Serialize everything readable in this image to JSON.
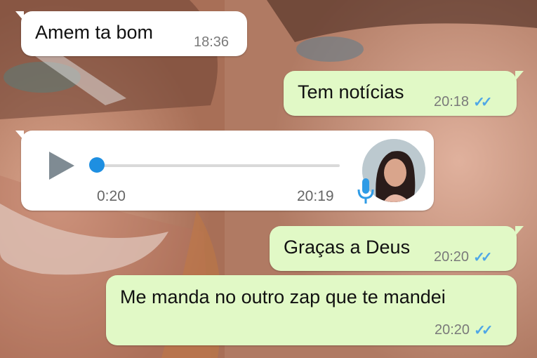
{
  "messages": [
    {
      "text": "Amem ta bom",
      "time": "18:36"
    },
    {
      "text": "Tem notícias",
      "time": "20:18"
    },
    {
      "voice_duration": "0:20",
      "time": "20:19"
    },
    {
      "text": "Graças a Deus",
      "time": "20:20"
    },
    {
      "text": "Me manda no outro zap que te mandei",
      "time": "20:20"
    }
  ],
  "colors": {
    "incoming_bubble": "#ffffff",
    "outgoing_bubble": "#e1f9c6",
    "read_ticks": "#4fa7e6",
    "voice_progress": "#1e8fe1"
  },
  "icons": {
    "read_receipt": "double-check-icon",
    "play": "play-icon",
    "microphone": "microphone-icon"
  }
}
